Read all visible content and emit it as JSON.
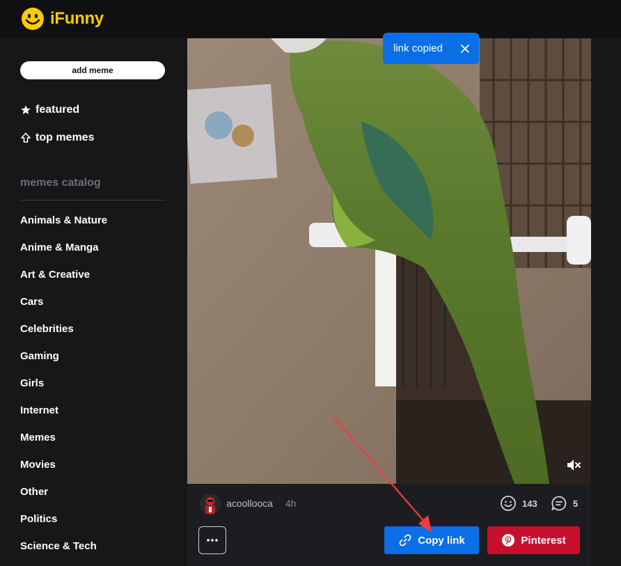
{
  "header": {
    "logo_text": "iFunny",
    "brand_color": "#ffcc00"
  },
  "sidebar": {
    "add_meme_label": "add meme",
    "nav": [
      {
        "label": "featured",
        "icon": "star-icon"
      },
      {
        "label": "top memes",
        "icon": "arrow-up-icon"
      }
    ],
    "catalog_heading": "memes catalog",
    "categories": [
      "Animals & Nature",
      "Anime & Manga",
      "Art & Creative",
      "Cars",
      "Celebrities",
      "Gaming",
      "Girls",
      "Internet",
      "Memes",
      "Movies",
      "Other",
      "Politics",
      "Science & Tech"
    ]
  },
  "post": {
    "username": "acoollooca",
    "time": "4h",
    "smiles": "143",
    "comments": "5",
    "copy_link_label": "Copy link",
    "pinterest_label": "Pinterest"
  },
  "toast": {
    "text": "link copied"
  },
  "colors": {
    "accent_blue": "#0a6ee6",
    "pinterest_red": "#c8102e"
  }
}
